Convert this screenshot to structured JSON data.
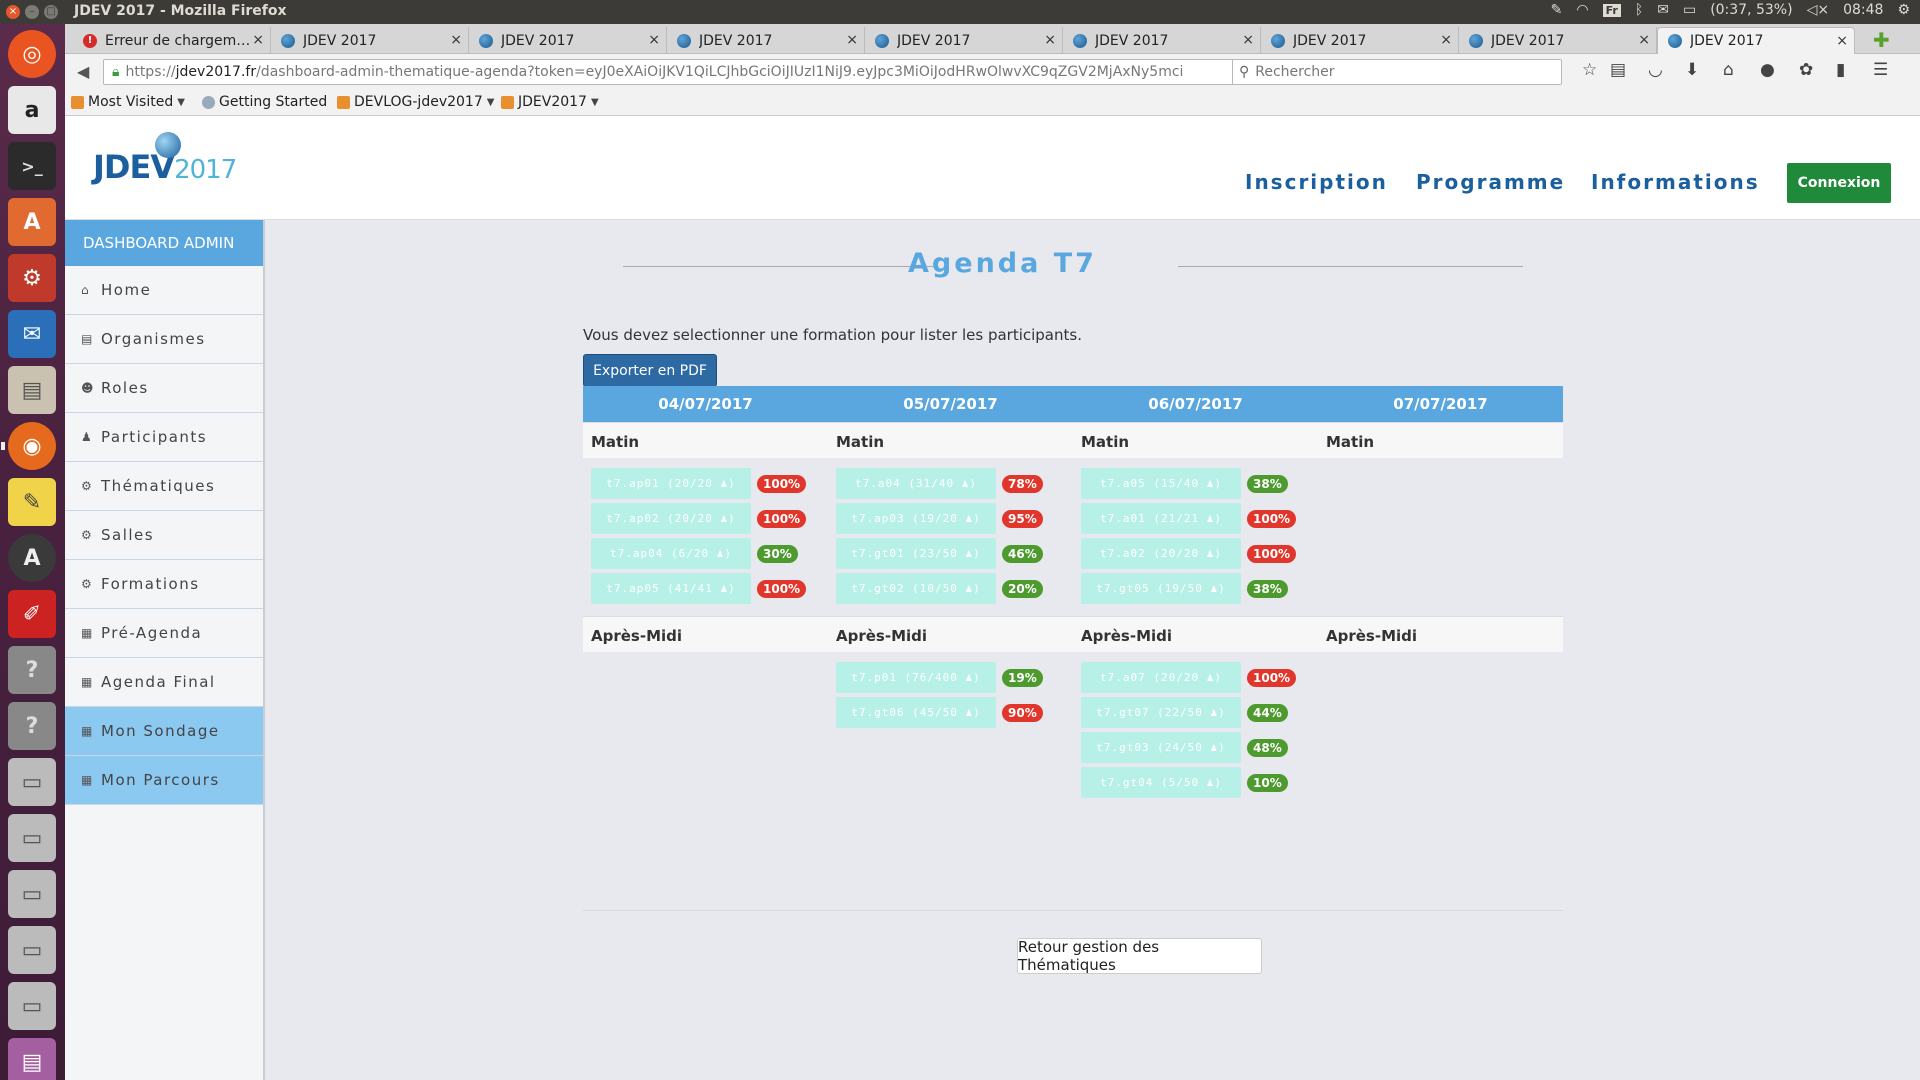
{
  "system": {
    "window_title": "JDEV 2017 - Mozilla Firefox",
    "keyboard_layout": "Fr",
    "battery": "(0:37, 53%)",
    "clock": "08:48"
  },
  "browser": {
    "tabs": [
      {
        "label": "Erreur de chargem…",
        "error": true
      },
      {
        "label": "JDEV 2017"
      },
      {
        "label": "JDEV 2017"
      },
      {
        "label": "JDEV 2017"
      },
      {
        "label": "JDEV 2017"
      },
      {
        "label": "JDEV 2017"
      },
      {
        "label": "JDEV 2017"
      },
      {
        "label": "JDEV 2017"
      },
      {
        "label": "JDEV 2017",
        "active": true
      }
    ],
    "url_prefix": "https://",
    "url_domain": "jdev2017.fr",
    "url_path": "/dashboard-admin-thematique-agenda?token=eyJ0eXAiOiJKV1QiLCJhbGciOiJIUzI1NiJ9.eyJpc3MiOiJodHRwOlwvXC9qZGV2MjAxNy5mci",
    "search_placeholder": "Rechercher",
    "bookmarks": [
      {
        "label": "Most Visited",
        "dropdown": true
      },
      {
        "label": "Getting Started",
        "dropdown": false
      },
      {
        "label": "DEVLOG-jdev2017",
        "dropdown": true
      },
      {
        "label": "JDEV2017",
        "dropdown": true
      }
    ]
  },
  "site": {
    "logo_main": "JDEV",
    "logo_year": "2017",
    "nav": [
      "Inscription",
      "Programme",
      "Informations"
    ],
    "login_button": "Connexion"
  },
  "sidebar": {
    "title": "DASHBOARD ADMIN",
    "items": [
      {
        "label": "Home",
        "icon": "home-icon",
        "glyph": "⌂",
        "highlight": false
      },
      {
        "label": "Organismes",
        "icon": "file-icon",
        "glyph": "▤",
        "highlight": false
      },
      {
        "label": "Roles",
        "icon": "users-icon",
        "glyph": "☻",
        "highlight": false
      },
      {
        "label": "Participants",
        "icon": "user-icon",
        "glyph": "♟",
        "highlight": false
      },
      {
        "label": "Thématiques",
        "icon": "cogs-icon",
        "glyph": "⚙",
        "highlight": false
      },
      {
        "label": "Salles",
        "icon": "cogs-icon",
        "glyph": "⚙",
        "highlight": false
      },
      {
        "label": "Formations",
        "icon": "cogs-icon",
        "glyph": "⚙",
        "highlight": false
      },
      {
        "label": "Pré-Agenda",
        "icon": "calendar-icon",
        "glyph": "▦",
        "highlight": false
      },
      {
        "label": "Agenda Final",
        "icon": "calendar-icon",
        "glyph": "▦",
        "highlight": false
      },
      {
        "label": "Mon Sondage",
        "icon": "calendar-icon",
        "glyph": "▦",
        "highlight": true
      },
      {
        "label": "Mon Parcours",
        "icon": "calendar-icon",
        "glyph": "▦",
        "highlight": true
      }
    ]
  },
  "agenda": {
    "title": "Agenda T7",
    "info": "Vous devez selectionner une formation pour lister les participants.",
    "export_button": "Exporter en PDF",
    "morning_label": "Matin",
    "afternoon_label": "Après-Midi",
    "back_button": "Retour gestion des Thématiques",
    "days": [
      {
        "date": "04/07/2017",
        "morning": [
          {
            "label": "t7.ap01 (20/20 ♟)",
            "pct": "100%",
            "status": "red"
          },
          {
            "label": "t7.ap02 (20/20 ♟)",
            "pct": "100%",
            "status": "red"
          },
          {
            "label": "t7.ap04 (6/20 ♟)",
            "pct": "30%",
            "status": "green"
          },
          {
            "label": "t7.ap05 (41/41 ♟)",
            "pct": "100%",
            "status": "red"
          }
        ],
        "afternoon": []
      },
      {
        "date": "05/07/2017",
        "morning": [
          {
            "label": "t7.a04 (31/40 ♟)",
            "pct": "78%",
            "status": "red"
          },
          {
            "label": "t7.ap03 (19/20 ♟)",
            "pct": "95%",
            "status": "red"
          },
          {
            "label": "t7.gt01 (23/50 ♟)",
            "pct": "46%",
            "status": "green"
          },
          {
            "label": "t7.gt02 (10/50 ♟)",
            "pct": "20%",
            "status": "green"
          }
        ],
        "afternoon": [
          {
            "label": "t7.p01 (76/400 ♟)",
            "pct": "19%",
            "status": "green"
          },
          {
            "label": "t7.gt06 (45/50 ♟)",
            "pct": "90%",
            "status": "red"
          }
        ]
      },
      {
        "date": "06/07/2017",
        "morning": [
          {
            "label": "t7.a05 (15/40 ♟)",
            "pct": "38%",
            "status": "green"
          },
          {
            "label": "t7.a01 (21/21 ♟)",
            "pct": "100%",
            "status": "red"
          },
          {
            "label": "t7.a02 (20/20 ♟)",
            "pct": "100%",
            "status": "red"
          },
          {
            "label": "t7.gt05 (19/50 ♟)",
            "pct": "38%",
            "status": "green"
          }
        ],
        "afternoon": [
          {
            "label": "t7.a07 (20/20 ♟)",
            "pct": "100%",
            "status": "red"
          },
          {
            "label": "t7.gt07 (22/50 ♟)",
            "pct": "44%",
            "status": "green"
          },
          {
            "label": "t7.gt03 (24/50 ♟)",
            "pct": "48%",
            "status": "green"
          },
          {
            "label": "t7.gt04 (5/50 ♟)",
            "pct": "10%",
            "status": "green"
          }
        ]
      },
      {
        "date": "07/07/2017",
        "morning": [],
        "afternoon": []
      }
    ]
  }
}
